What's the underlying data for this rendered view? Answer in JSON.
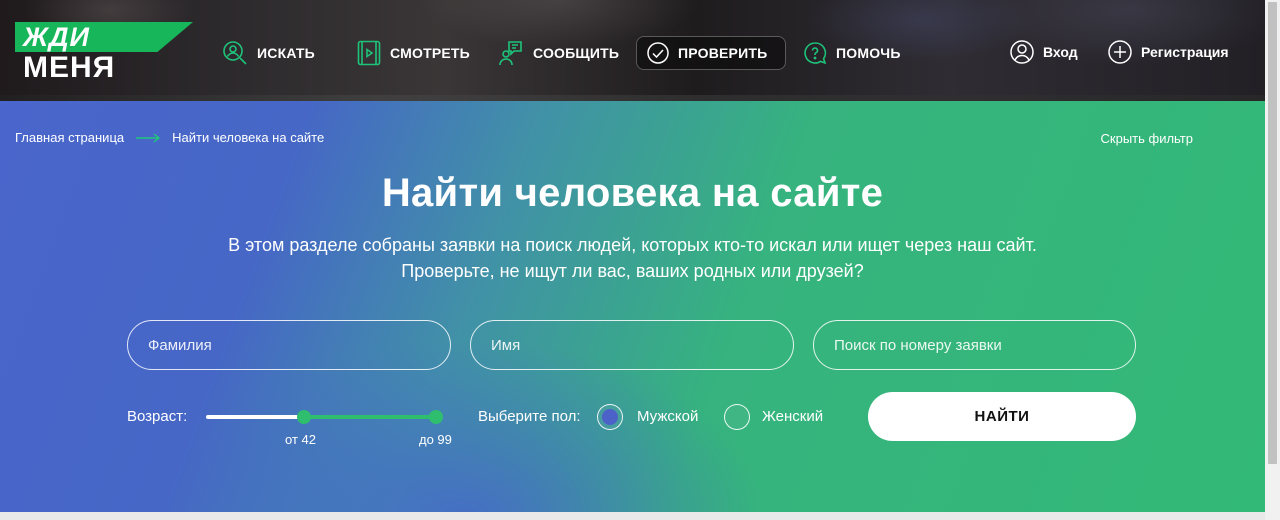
{
  "header": {
    "logo": {
      "line1": "ЖДИ",
      "line2": "МЕНЯ"
    },
    "nav": [
      {
        "label": "ИСКАТЬ",
        "icon": "search-person-icon"
      },
      {
        "label": "СМОТРЕТЬ",
        "icon": "video-icon"
      },
      {
        "label": "СООБЩИТЬ",
        "icon": "message-person-icon"
      },
      {
        "label": "ПРОВЕРИТЬ",
        "icon": "check-circle-icon",
        "active": true
      },
      {
        "label": "ПОМОЧЬ",
        "icon": "help-bubble-icon"
      }
    ],
    "login_label": "Вход",
    "register_label": "Регистрация",
    "accent_color": "#17b65a"
  },
  "hero": {
    "breadcrumb": {
      "home": "Главная страница",
      "current": "Найти человека на сайте"
    },
    "hide_filter": "Скрыть фильтр",
    "title": "Найти человека на сайте",
    "subtitle_line1": "В этом разделе собраны заявки на поиск людей, которых кто-то искал или ищет через наш сайт.",
    "subtitle_line2": "Проверьте, не ищут ли вас, ваших родных или друзей?",
    "fields": {
      "surname_placeholder": "Фамилия",
      "name_placeholder": "Имя",
      "request_placeholder": "Поиск по номеру заявки"
    },
    "age": {
      "label": "Возраст:",
      "min_label": "от 42",
      "max_label": "до 99",
      "range_min": 0,
      "range_max": 99,
      "value_from": 42,
      "value_to": 99
    },
    "gender": {
      "label": "Выберите пол:",
      "options": [
        {
          "label": "Мужской",
          "checked": true
        },
        {
          "label": "Женский",
          "checked": false
        }
      ]
    },
    "find_button": "НАЙТИ"
  }
}
